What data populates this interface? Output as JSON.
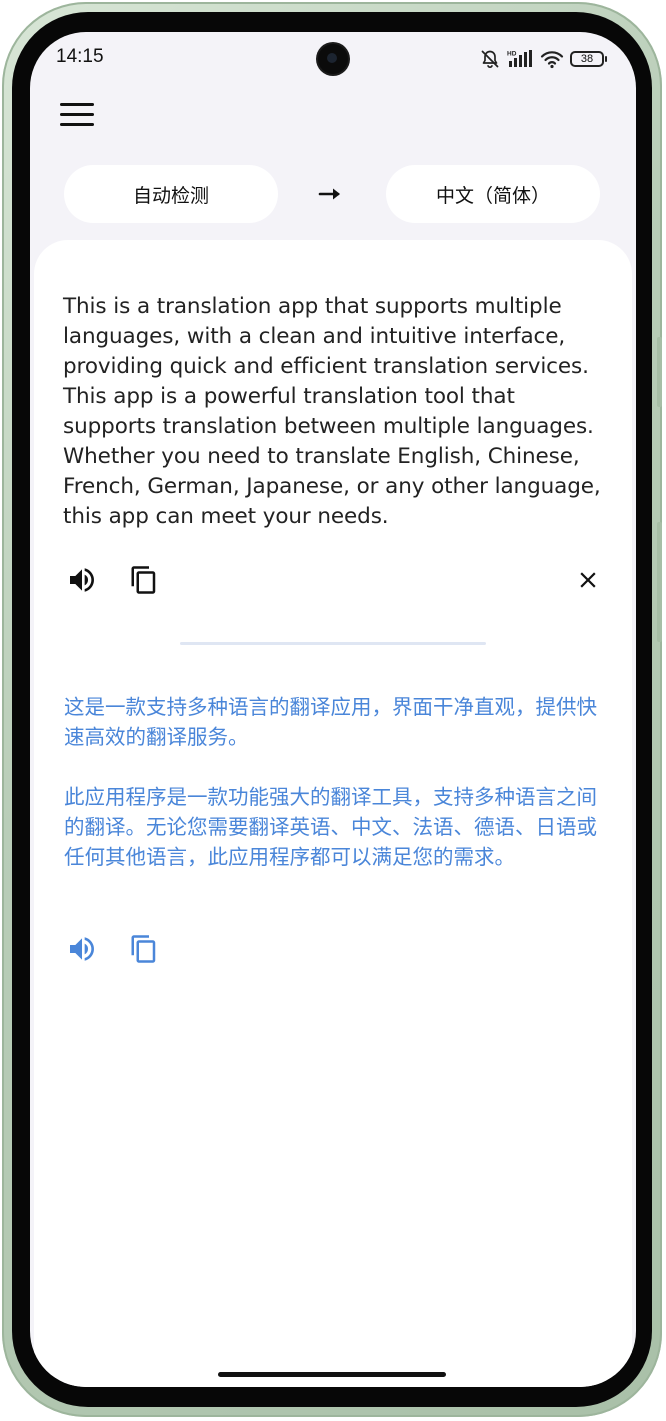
{
  "status_bar": {
    "time": "14:15",
    "network_label": "HD",
    "battery_level": "38"
  },
  "colors": {
    "accent": "#4a86d9",
    "background": "#f4f3f8",
    "card": "#ffffff",
    "text": "#222222"
  },
  "header": {
    "menu_icon": "hamburger-menu-icon"
  },
  "languages": {
    "source": "自动检测",
    "target": "中文（简体）",
    "swap_icon": "right-arrow-icon"
  },
  "source": {
    "text": "This is a translation app that supports multiple languages, with a clean and intuitive interface, providing quick and efficient translation services. This app is a powerful translation tool that supports translation between multiple languages. Whether you need to translate English, Chinese, French, German, Japanese, or any other language, this app can meet your needs.",
    "actions": [
      "speaker-icon",
      "copy-icon",
      "close-icon"
    ]
  },
  "translation": {
    "text": "这是一款支持多种语言的翻译应用，界面干净直观，提供快速高效的翻译服务。\n\n此应用程序是一款功能强大的翻译工具，支持多种语言之间的翻译。无论您需要翻译英语、中文、法语、德语、日语或任何其他语言，此应用程序都可以满足您的需求。",
    "actions": [
      "speaker-icon",
      "copy-icon"
    ]
  }
}
